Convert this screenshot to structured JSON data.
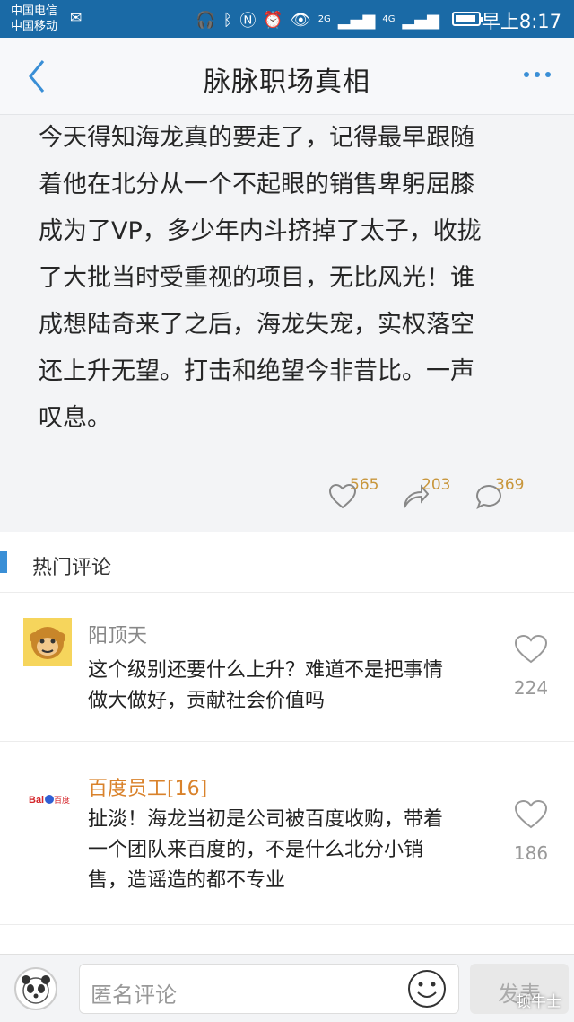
{
  "status_bar": {
    "carrier_1": "中国电信",
    "carrier_2": "中国移动",
    "net_a": "2G",
    "net_b": "4G",
    "time": "早上8:17",
    "battery_level": 0.92
  },
  "nav": {
    "title": "脉脉职场真相"
  },
  "post": {
    "lines": [
      "今天得知海龙真的要走了，记得最早跟随",
      "着他在北分从一个不起眼的销售卑躬屈膝",
      "成为了VP，多少年内斗挤掉了太子，收拢",
      "了大批当时受重视的项目，无比风光！谁",
      "成想陆奇来了之后，海龙失宠，实权落空",
      "还上升无望。打击和绝望今非昔比。一声",
      "叹息。"
    ],
    "likes": "565",
    "shares": "203",
    "comments": "369"
  },
  "section": {
    "title": "热门评论"
  },
  "comments": [
    {
      "name": "阳顶天",
      "lines": [
        "这个级别还要什么上升？难道不是把事情",
        "做大做好，贡献社会价值吗"
      ],
      "likes": "224"
    },
    {
      "name": "百度员工[16]",
      "avatar_text": "百度",
      "lines": [
        "扯淡！海龙当初是公司被百度收购，带着",
        "一个团队来百度的，不是什么北分小销",
        "售，造谣造的都不专业"
      ],
      "likes": "186"
    }
  ],
  "bottom": {
    "placeholder": "匿名评论",
    "send": "发表",
    "watermark": "顿牛士"
  },
  "colors": {
    "status_bar": "#1a6aa6",
    "accent": "#3a8fd6",
    "count": "#c8963c",
    "baidu_name": "#d9822b"
  }
}
